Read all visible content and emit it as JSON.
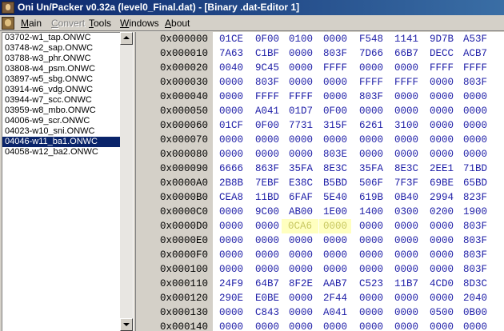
{
  "window": {
    "title": "Oni Un/Packer v0.32a (level0_Final.dat) - [Binary .dat-Editor 1]"
  },
  "menu": {
    "items": [
      {
        "label": "Main",
        "enabled": true
      },
      {
        "label": "Convert",
        "enabled": false
      },
      {
        "label": "Tools",
        "enabled": true
      },
      {
        "label": "Windows",
        "enabled": true
      },
      {
        "label": "About",
        "enabled": true
      }
    ]
  },
  "file_list": {
    "items": [
      "03702-w1_tap.ONWC",
      "03748-w2_sap.ONWC",
      "03788-w3_phr.ONWC",
      "03808-w4_psm.ONWC",
      "03897-w5_sbg.ONWC",
      "03914-w6_vdg.ONWC",
      "03944-w7_scc.ONWC",
      "03959-w8_mbo.ONWC",
      "04006-w9_scr.ONWC",
      "04023-w10_sni.ONWC",
      "04046-w11_ba1.ONWC",
      "04058-w12_ba2.ONWC"
    ],
    "selected_index": 10
  },
  "hex_editor": {
    "highlight_color": "#ffffc0",
    "rows": [
      {
        "addr": "0x000000",
        "words": [
          "01CE",
          "0F00",
          "0100",
          "0000",
          "F548",
          "1141",
          "9D7B",
          "A53F"
        ]
      },
      {
        "addr": "0x000010",
        "words": [
          "7A63",
          "C1BF",
          "0000",
          "803F",
          "7D66",
          "66B7",
          "DECC",
          "ACB7"
        ]
      },
      {
        "addr": "0x000020",
        "words": [
          "0040",
          "9C45",
          "0000",
          "FFFF",
          "0000",
          "0000",
          "FFFF",
          "FFFF"
        ]
      },
      {
        "addr": "0x000030",
        "words": [
          "0000",
          "803F",
          "0000",
          "0000",
          "FFFF",
          "FFFF",
          "0000",
          "803F"
        ]
      },
      {
        "addr": "0x000040",
        "words": [
          "0000",
          "FFFF",
          "FFFF",
          "0000",
          "803F",
          "0000",
          "0000",
          "0000"
        ]
      },
      {
        "addr": "0x000050",
        "words": [
          "0000",
          "A041",
          "01D7",
          "0F00",
          "0000",
          "0000",
          "0000",
          "0000"
        ]
      },
      {
        "addr": "0x000060",
        "words": [
          "01CF",
          "0F00",
          "7731",
          "315F",
          "6261",
          "3100",
          "0000",
          "0000"
        ]
      },
      {
        "addr": "0x000070",
        "words": [
          "0000",
          "0000",
          "0000",
          "0000",
          "0000",
          "0000",
          "0000",
          "0000"
        ]
      },
      {
        "addr": "0x000080",
        "words": [
          "0000",
          "0000",
          "0000",
          "803E",
          "0000",
          "0000",
          "0000",
          "0000"
        ]
      },
      {
        "addr": "0x000090",
        "words": [
          "6666",
          "863F",
          "35FA",
          "8E3C",
          "35FA",
          "8E3C",
          "2EE1",
          "71BD"
        ]
      },
      {
        "addr": "0x0000A0",
        "words": [
          "2B8B",
          "7EBF",
          "E38C",
          "B5BD",
          "506F",
          "7F3F",
          "69BE",
          "65BD"
        ]
      },
      {
        "addr": "0x0000B0",
        "words": [
          "CEA8",
          "11BD",
          "6FAF",
          "5E40",
          "619B",
          "0B40",
          "2994",
          "823F"
        ]
      },
      {
        "addr": "0x0000C0",
        "words": [
          "0000",
          "9C00",
          "AB00",
          "1E00",
          "1400",
          "0300",
          "0200",
          "1900"
        ]
      },
      {
        "addr": "0x0000D0",
        "words": [
          "0000",
          "0000",
          "0CA6",
          "0000",
          "0000",
          "0000",
          "0000",
          "803F"
        ],
        "highlight": [
          2,
          3
        ]
      },
      {
        "addr": "0x0000E0",
        "words": [
          "0000",
          "0000",
          "0000",
          "0000",
          "0000",
          "0000",
          "0000",
          "803F"
        ]
      },
      {
        "addr": "0x0000F0",
        "words": [
          "0000",
          "0000",
          "0000",
          "0000",
          "0000",
          "0000",
          "0000",
          "803F"
        ]
      },
      {
        "addr": "0x000100",
        "words": [
          "0000",
          "0000",
          "0000",
          "0000",
          "0000",
          "0000",
          "0000",
          "803F"
        ]
      },
      {
        "addr": "0x000110",
        "words": [
          "24F9",
          "64B7",
          "8F2E",
          "AAB7",
          "C523",
          "11B7",
          "4CD0",
          "8D3C"
        ]
      },
      {
        "addr": "0x000120",
        "words": [
          "290E",
          "E0BE",
          "0000",
          "2F44",
          "0000",
          "0000",
          "0000",
          "2040"
        ]
      },
      {
        "addr": "0x000130",
        "words": [
          "0000",
          "C843",
          "0000",
          "A041",
          "0000",
          "0000",
          "0500",
          "0B00"
        ]
      },
      {
        "addr": "0x000140",
        "words": [
          "0000",
          "0000",
          "0000",
          "0000",
          "0000",
          "0000",
          "0000",
          "0000"
        ]
      }
    ]
  },
  "icons": {
    "app": "oni-app-icon",
    "menu_doc": "oni-doc-icon"
  }
}
